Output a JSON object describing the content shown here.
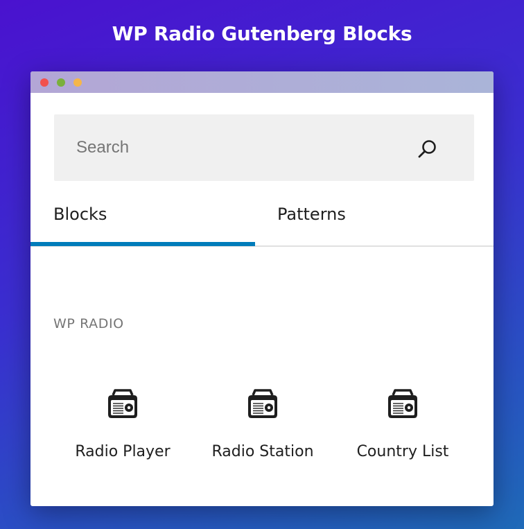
{
  "header": {
    "title": "WP Radio Gutenberg Blocks"
  },
  "search": {
    "placeholder": "Search",
    "value": "",
    "icon": "search-icon"
  },
  "tabs": [
    {
      "label": "Blocks",
      "active": true
    },
    {
      "label": "Patterns",
      "active": false
    }
  ],
  "category": {
    "title": "WP RADIO"
  },
  "blocks": [
    {
      "label": "Radio Player",
      "icon": "radio-icon"
    },
    {
      "label": "Radio Station",
      "icon": "radio-icon"
    },
    {
      "label": "Country List",
      "icon": "radio-icon"
    }
  ],
  "colors": {
    "tab_active_indicator": "#007cba",
    "window_dot_red": "#f2514f",
    "window_dot_green": "#7ab03c",
    "window_dot_yellow": "#f5b64a"
  }
}
